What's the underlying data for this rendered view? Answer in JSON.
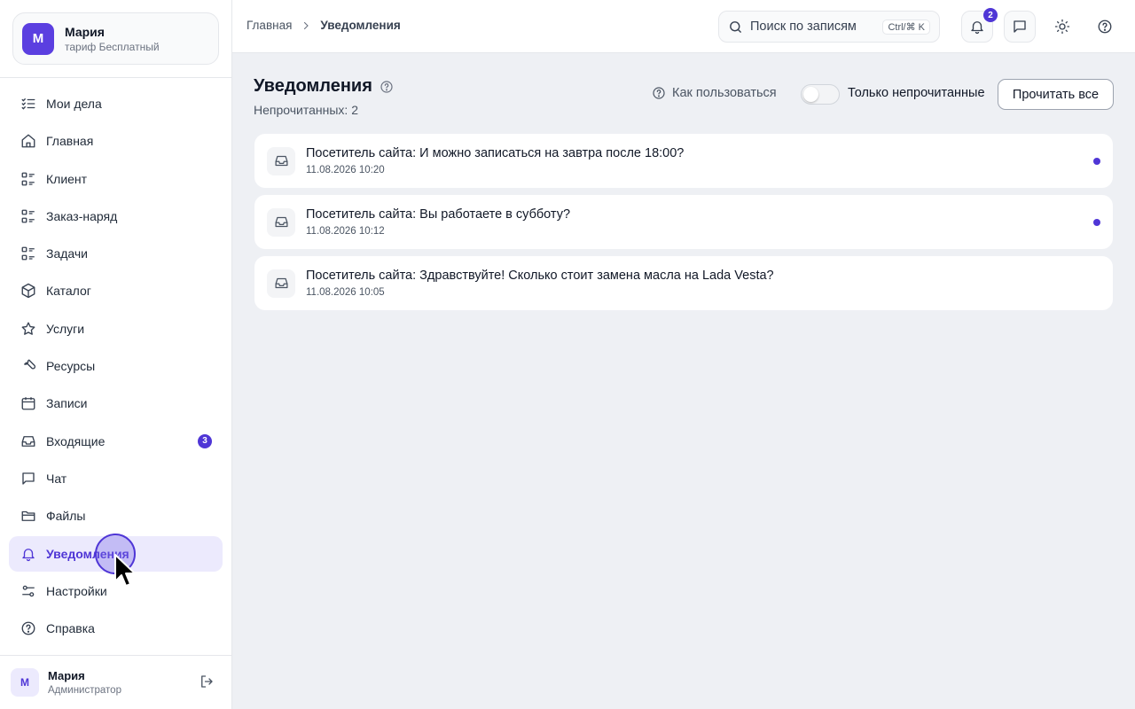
{
  "account": {
    "initial": "М",
    "name": "Мария",
    "plan": "тариф Бесплатный"
  },
  "sidebar": {
    "items": [
      {
        "label": "Мои дела",
        "icon": "list-checks-icon"
      },
      {
        "label": "Главная",
        "icon": "home-icon"
      },
      {
        "label": "Клиент",
        "icon": "list-grid-icon"
      },
      {
        "label": "Заказ-наряд",
        "icon": "list-grid-icon"
      },
      {
        "label": "Задачи",
        "icon": "list-grid-icon"
      },
      {
        "label": "Каталог",
        "icon": "box-icon"
      },
      {
        "label": "Услуги",
        "icon": "star-icon"
      },
      {
        "label": "Ресурсы",
        "icon": "wrench-icon"
      },
      {
        "label": "Записи",
        "icon": "calendar-icon"
      },
      {
        "label": "Входящие",
        "icon": "inbox-icon",
        "badge": "3"
      },
      {
        "label": "Чат",
        "icon": "chat-icon"
      },
      {
        "label": "Файлы",
        "icon": "folder-icon"
      },
      {
        "label": "Уведомления",
        "icon": "bell-icon",
        "active": true
      },
      {
        "label": "Настройки",
        "icon": "sliders-icon"
      },
      {
        "label": "Справка",
        "icon": "help-circle-icon"
      }
    ]
  },
  "user": {
    "initial": "М",
    "name": "Мария",
    "role": "Администратор"
  },
  "header": {
    "breadcrumb_home": "Главная",
    "breadcrumb_current": "Уведомления",
    "search_placeholder": "Поиск по записям",
    "search_shortcut": "Ctrl/⌘ K",
    "notifications_badge": "2"
  },
  "main": {
    "title": "Уведомления",
    "unread_text": "Непрочитанных: 2",
    "howto_label": "Как пользоваться",
    "toggle_label": "Только непрочитанные",
    "toggle_on": false,
    "read_all_label": "Прочитать все"
  },
  "notifications": [
    {
      "message": "Посетитель сайта: И можно записаться на завтра после 18:00?",
      "time": "11.08.2026 10:20",
      "unread": true
    },
    {
      "message": "Посетитель сайта: Вы работаете в субботу?",
      "time": "11.08.2026 10:12",
      "unread": true
    },
    {
      "message": "Посетитель сайта: Здравствуйте! Сколько стоит замена масла на Lada Vesta?",
      "time": "11.08.2026 10:05",
      "unread": false
    }
  ],
  "colors": {
    "accent": "#4f36d6",
    "avatar": "#5b3fe0",
    "active_bg": "#eceafd",
    "page_bg": "#eef0f4"
  }
}
